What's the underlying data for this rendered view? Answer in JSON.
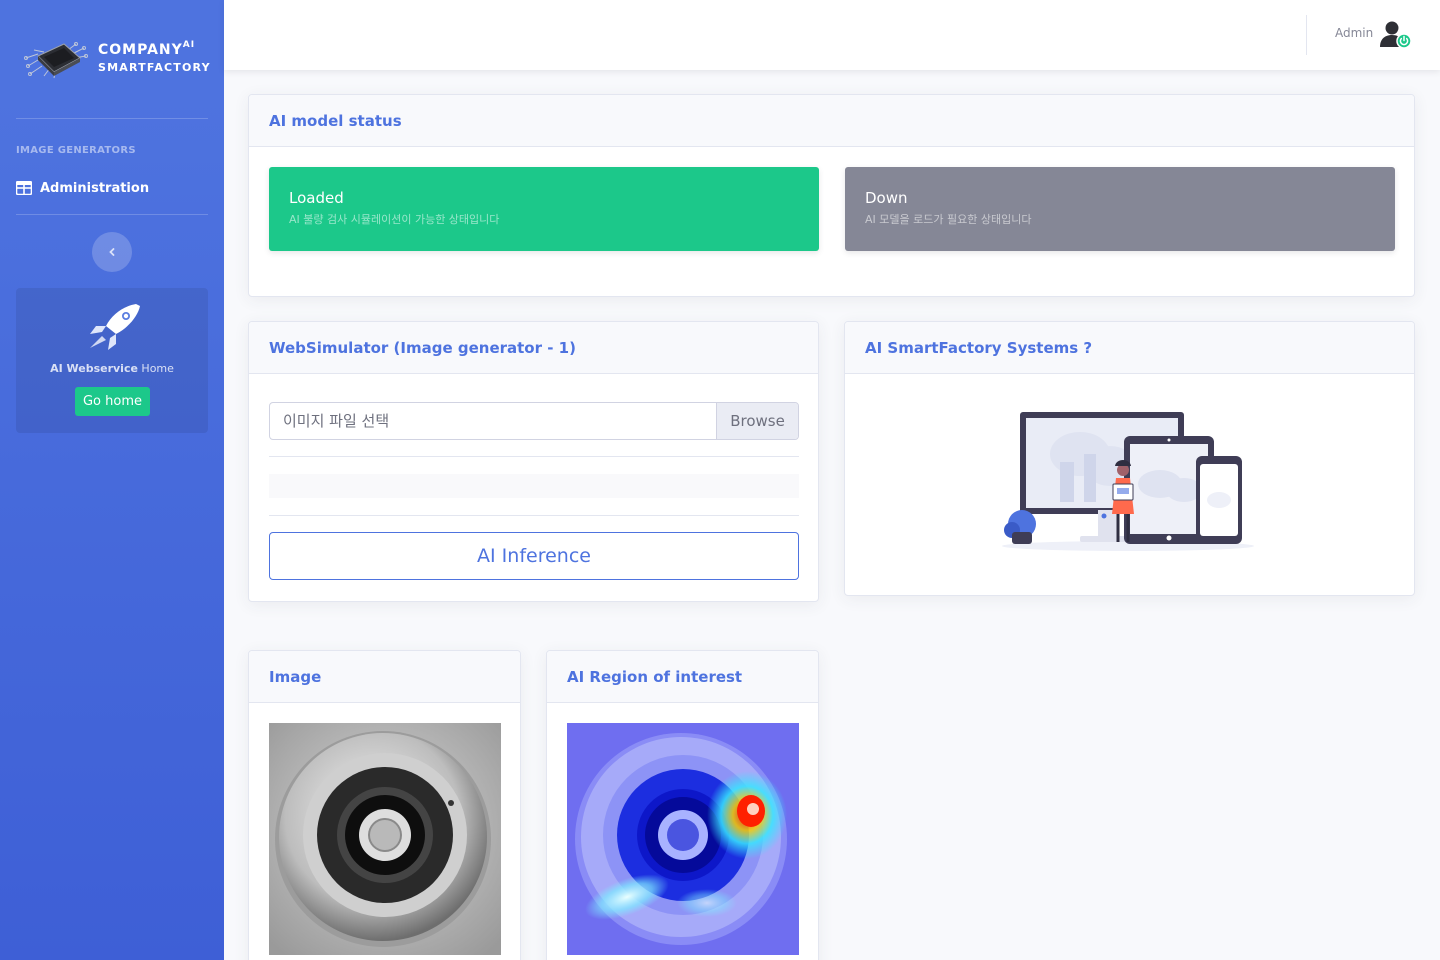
{
  "brand": {
    "name": "COMPANY",
    "superscript": "AI",
    "subtitle": "SMARTFACTORY"
  },
  "sidebar": {
    "heading": "IMAGE GENERATORS",
    "items": [
      {
        "label": "Administration",
        "icon": "table-icon"
      }
    ],
    "toggle_icon": "chevron-left-icon",
    "promo": {
      "text_bold": "AI Webservice",
      "text": " Home",
      "button": "Go home"
    }
  },
  "topbar": {
    "user": "Admin",
    "avatar_icon": "user-power-icon"
  },
  "status_card": {
    "title": "AI model status",
    "tiles": [
      {
        "title": "Loaded",
        "subtitle": "AI 불량 검사 시뮬레이션이 가능한 상태입니다",
        "color": "#1cc88a"
      },
      {
        "title": "Down",
        "subtitle": "AI 모델을 로드가 필요한 상태입니다",
        "color": "#858796"
      }
    ]
  },
  "simulator_card": {
    "title": "WebSimulator (Image generator - 1)",
    "file_label": "이미지 파일 선택",
    "browse": "Browse",
    "button": "AI Inference"
  },
  "systems_card": {
    "title": "AI SmartFactory Systems ?"
  },
  "image_card": {
    "title": "Image"
  },
  "roi_card": {
    "title": "AI Region of interest"
  },
  "colors": {
    "primary": "#4e73df",
    "success": "#1cc88a",
    "secondary": "#858796"
  }
}
